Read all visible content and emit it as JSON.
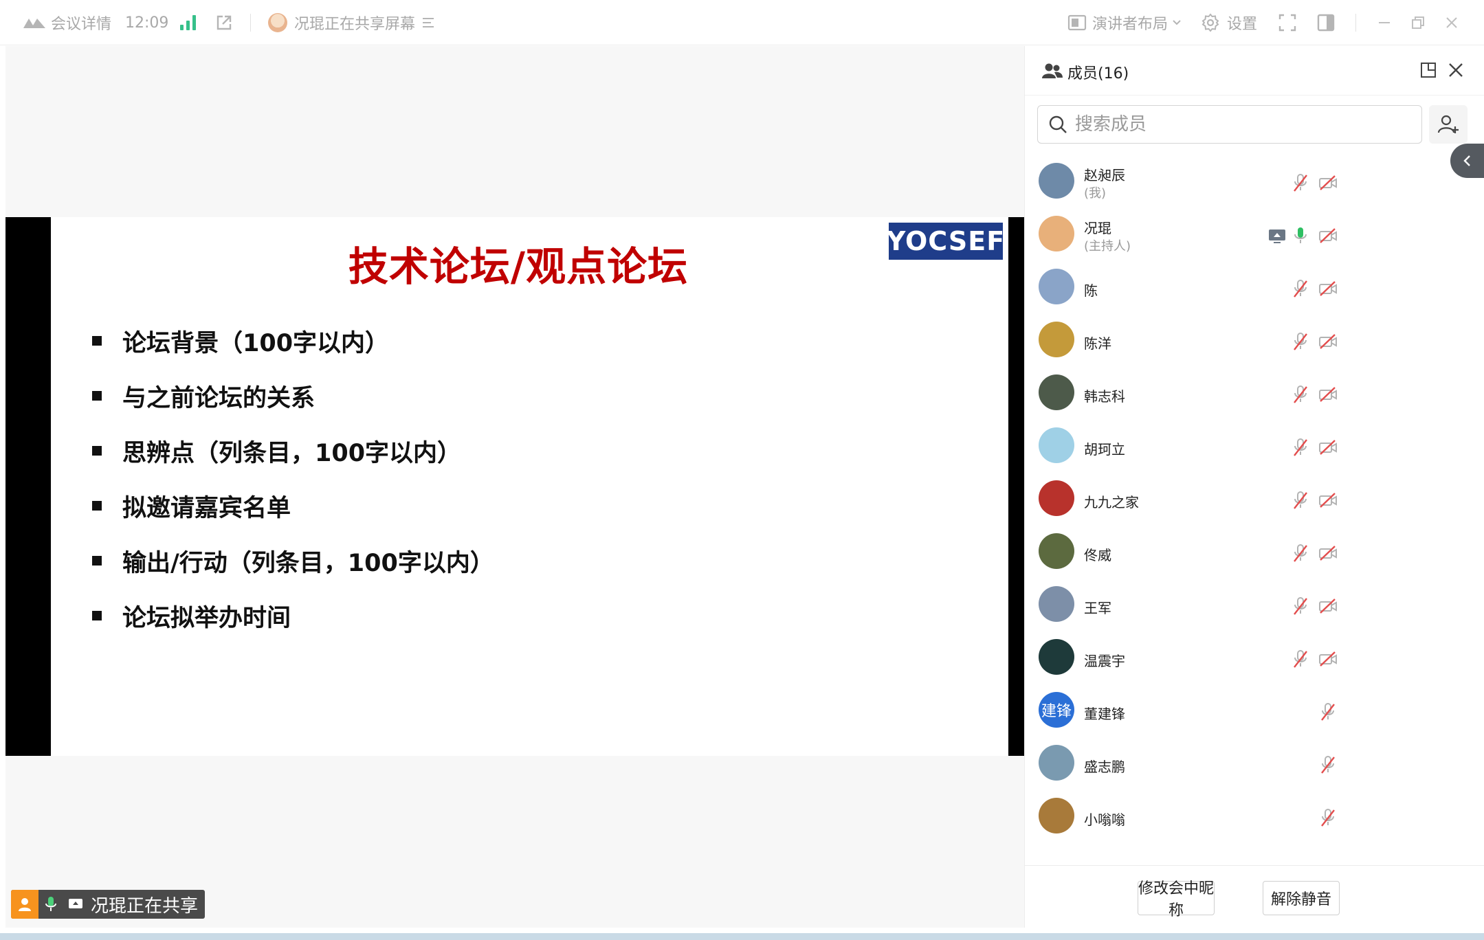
{
  "topbar": {
    "meeting_details": "会议详情",
    "time": "12:09",
    "sharing_text": "况琨正在共享屏幕",
    "layout_label": "演讲者布局",
    "settings_label": "设置"
  },
  "slide": {
    "title": "技术论坛/观点论坛",
    "logo_text": "YOCSEF",
    "bullets": [
      "论坛背景（100字以内）",
      "与之前论坛的关系",
      "思辨点（列条目，100字以内）",
      "拟邀请嘉宾名单",
      "输出/行动（列条目，100字以内）",
      "论坛拟举办时间"
    ]
  },
  "share_badge": {
    "text": "况琨正在共享"
  },
  "panel": {
    "title": "成员(16)",
    "search_placeholder": "搜索成员",
    "members": [
      {
        "name": "赵昶辰",
        "role": "(我)",
        "avatar_color": "#6e8aa8",
        "mic": "muted",
        "cam": "off",
        "sharing": false
      },
      {
        "name": "况琨",
        "role": "(主持人)",
        "avatar_color": "#e8b07a",
        "mic": "on",
        "cam": "off",
        "sharing": true
      },
      {
        "name": "陈",
        "role": "",
        "avatar_color": "#8aa4c8",
        "mic": "muted",
        "cam": "off",
        "sharing": false
      },
      {
        "name": "陈洋",
        "role": "",
        "avatar_color": "#c49a3a",
        "mic": "muted",
        "cam": "off",
        "sharing": false
      },
      {
        "name": "韩志科",
        "role": "",
        "avatar_color": "#4d5a4a",
        "mic": "muted",
        "cam": "off",
        "sharing": false
      },
      {
        "name": "胡珂立",
        "role": "",
        "avatar_color": "#9fd0e6",
        "mic": "muted",
        "cam": "off",
        "sharing": false
      },
      {
        "name": "九九之家",
        "role": "",
        "avatar_color": "#b8322c",
        "mic": "muted",
        "cam": "off",
        "sharing": false
      },
      {
        "name": "佟威",
        "role": "",
        "avatar_color": "#5c6a3f",
        "mic": "muted",
        "cam": "off",
        "sharing": false
      },
      {
        "name": "王军",
        "role": "",
        "avatar_color": "#7d8fa8",
        "mic": "muted",
        "cam": "off",
        "sharing": false
      },
      {
        "name": "温震宇",
        "role": "",
        "avatar_color": "#1e3a3a",
        "mic": "muted",
        "cam": "off",
        "sharing": false
      },
      {
        "name": "董建锋",
        "role": "",
        "avatar_color": "#2b6fd6",
        "avatar_text": "建锋",
        "mic": "muted",
        "cam": "none",
        "sharing": false
      },
      {
        "name": "盛志鹏",
        "role": "",
        "avatar_color": "#7a9ab0",
        "mic": "muted",
        "cam": "none",
        "sharing": false
      },
      {
        "name": "小嗡嗡",
        "role": "",
        "avatar_color": "#a87a3a",
        "mic": "muted",
        "cam": "none",
        "sharing": false
      },
      {
        "name": "",
        "role": "",
        "avatar_color": "#2b6fd6",
        "mic": "muted",
        "cam": "none",
        "sharing": false
      }
    ],
    "rename_button": "修改会中昵称",
    "unmute_button": "解除静音"
  }
}
